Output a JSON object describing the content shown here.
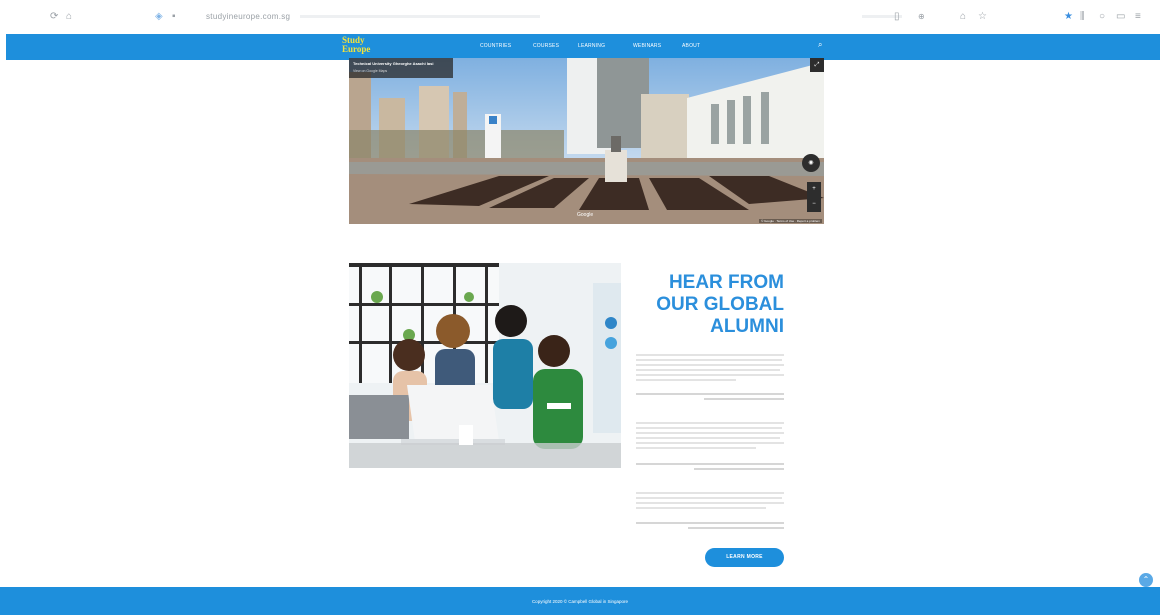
{
  "browser": {
    "url": "studyineurope.com.sg",
    "back_icon": "refresh-icon",
    "bookmark_icon": "star-icon"
  },
  "nav": {
    "logo_line1": "Study",
    "logo_line2": "Europe",
    "items": [
      "COUNTRIES",
      "COURSES",
      "LEARNING",
      "WEBINARS",
      "ABOUT"
    ],
    "search_icon": "search-icon"
  },
  "streetview": {
    "place_title": "Technical University Gheorghe Asachi Iasi",
    "view_link": "View on Google Maps",
    "google_label": "Google",
    "terms": "© Google · Terms of Use · Report a problem"
  },
  "alumni": {
    "heading_lines": [
      "HEAR FROM",
      "OUR GLOBAL",
      "ALUMNI"
    ],
    "button_label": "LEARN MORE"
  },
  "footer": {
    "copyright": "Copyright 2020 © Campbell Global in Singapore"
  },
  "colors": {
    "brand_blue": "#1e8fdc",
    "logo_yellow": "#f3e23a",
    "heading_blue": "#2b8fdc"
  }
}
